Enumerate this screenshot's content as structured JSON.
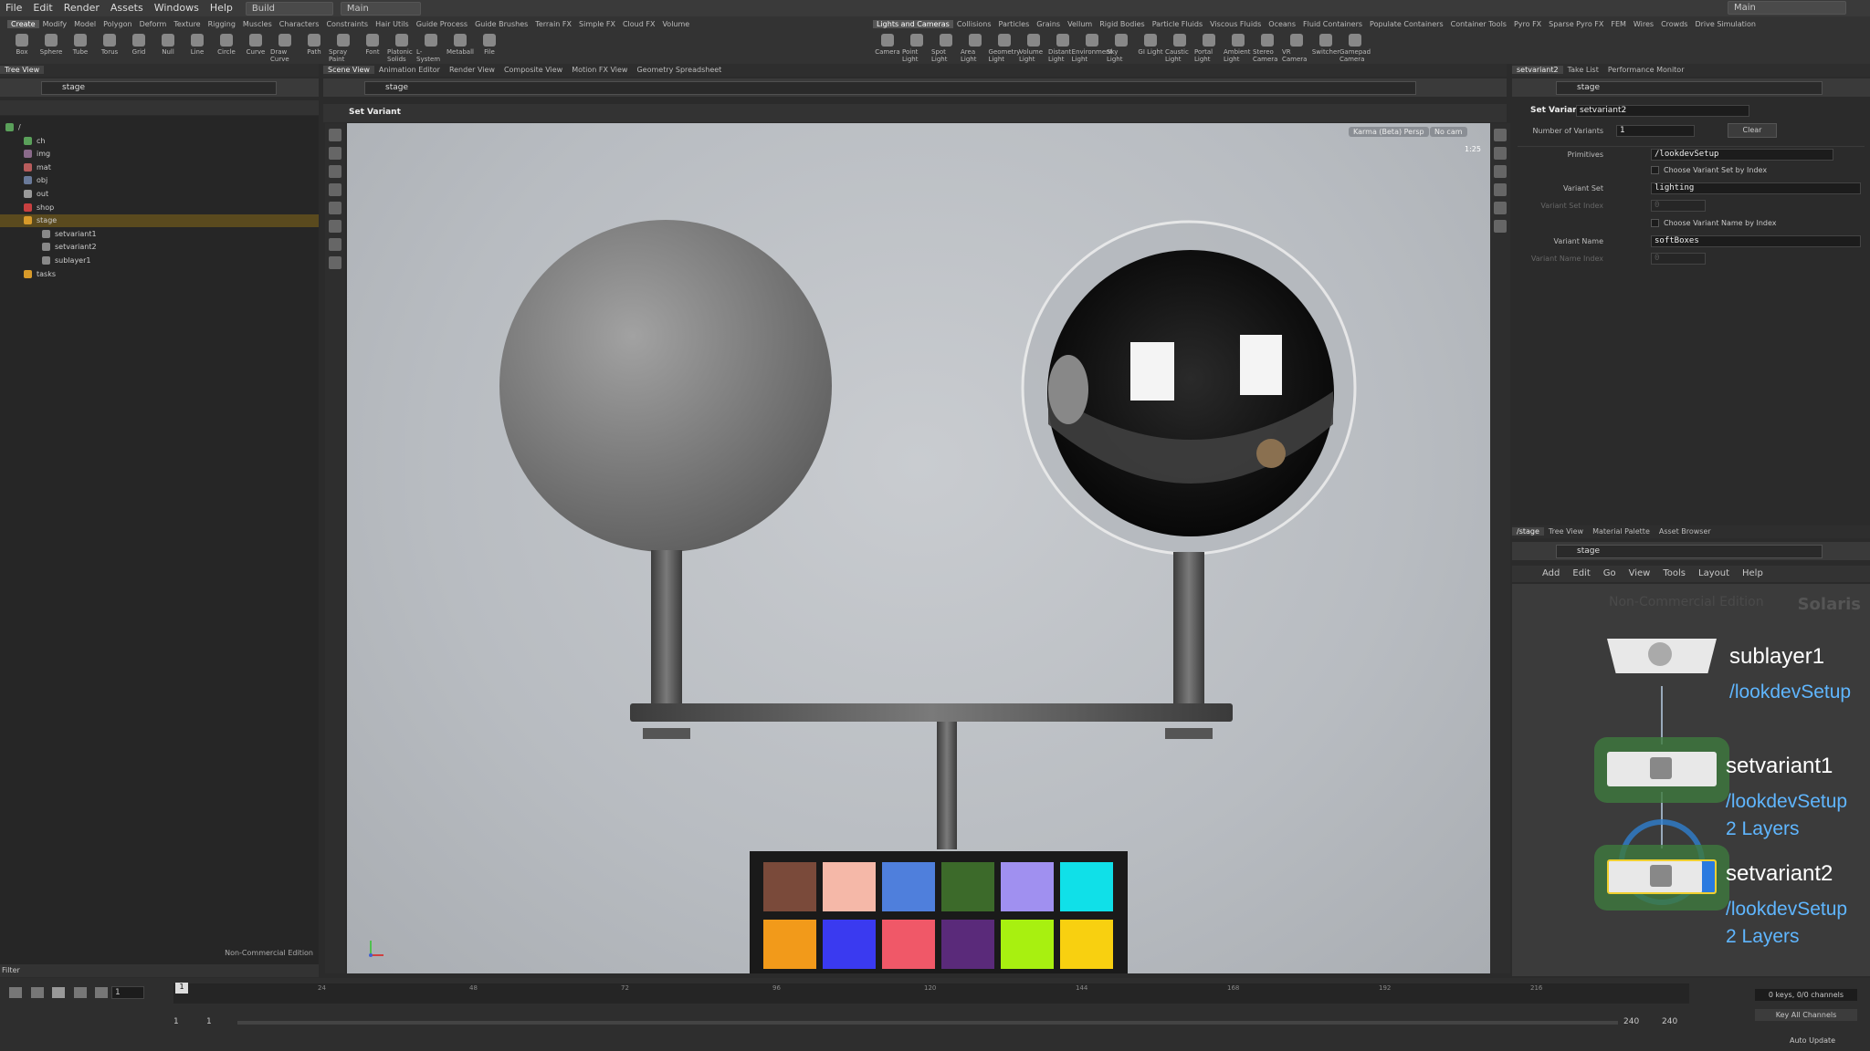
{
  "menubar": {
    "items": [
      "File",
      "Edit",
      "Render",
      "Assets",
      "Windows",
      "Help"
    ],
    "desktop": "Build",
    "network_context": "Main",
    "right_label": "Main"
  },
  "shelf": {
    "left_tabs": [
      "Create",
      "Modify",
      "Model",
      "Polygon",
      "Deform",
      "Texture",
      "Rigging",
      "Muscles",
      "Characters",
      "Constraints",
      "Hair Utils",
      "Guide Process",
      "Guide Brushes",
      "Terrain FX",
      "Simple FX",
      "Cloud FX",
      "Volume"
    ],
    "left_tools": [
      "Box",
      "Sphere",
      "Tube",
      "Torus",
      "Grid",
      "Null",
      "Line",
      "Circle",
      "Curve",
      "Draw Curve",
      "Path",
      "Spray Paint",
      "Font",
      "Platonic Solids",
      "L-System",
      "Metaball",
      "File"
    ],
    "right_tabs": [
      "Lights and Cameras",
      "Collisions",
      "Particles",
      "Grains",
      "Vellum",
      "Rigid Bodies",
      "Particle Fluids",
      "Viscous Fluids",
      "Oceans",
      "Fluid Containers",
      "Populate Containers",
      "Container Tools",
      "Pyro FX",
      "Sparse Pyro FX",
      "FEM",
      "Wires",
      "Crowds",
      "Drive Simulation"
    ],
    "right_tools": [
      "Camera",
      "Point Light",
      "Spot Light",
      "Area Light",
      "Geometry Light",
      "Volume Light",
      "Distant Light",
      "Environment Light",
      "Sky Light",
      "GI Light",
      "Caustic Light",
      "Portal Light",
      "Ambient Light",
      "Stereo Camera",
      "VR Camera",
      "Switcher",
      "Gamepad Camera"
    ]
  },
  "tree_pane": {
    "tab": "Tree View",
    "path": "stage",
    "nodes": [
      {
        "label": "/",
        "color": "#5aa05a",
        "indent": 0
      },
      {
        "label": "ch",
        "color": "#5aa05a",
        "indent": 1
      },
      {
        "label": "img",
        "color": "#8a6a8a",
        "indent": 1
      },
      {
        "label": "mat",
        "color": "#b85c5c",
        "indent": 1
      },
      {
        "label": "obj",
        "color": "#6a7a9a",
        "indent": 1
      },
      {
        "label": "out",
        "color": "#9a9a9a",
        "indent": 1
      },
      {
        "label": "shop",
        "color": "#c84040",
        "indent": 1
      },
      {
        "label": "stage",
        "color": "#d79a2a",
        "indent": 1,
        "selected": true
      },
      {
        "label": "setvariant1",
        "color": "#888888",
        "indent": 2
      },
      {
        "label": "setvariant2",
        "color": "#888888",
        "indent": 2
      },
      {
        "label": "sublayer1",
        "color": "#888888",
        "indent": 2
      },
      {
        "label": "tasks",
        "color": "#d79a2a",
        "indent": 1
      }
    ],
    "edition": "Non-Commercial Edition",
    "filter_label": "Filter"
  },
  "viewer": {
    "tabs": [
      "Scene View",
      "Animation Editor",
      "Render View",
      "Composite View",
      "Motion FX View",
      "Geometry Spreadsheet"
    ],
    "path": "stage",
    "node_title": "Set Variant",
    "renderer": "Karma (Beta) Persp",
    "camera": "No cam",
    "scale": "1:25",
    "colors": {
      "checker": [
        "#7a4a3a",
        "#f5b8a8",
        "#4f7fdc",
        "#3c6a2a",
        "#a090f0",
        "#10e0e8",
        "#f29a1a",
        "#3a3af0",
        "#f05868",
        "#5a2a7a",
        "#a8f010",
        "#f8d010"
      ]
    }
  },
  "params": {
    "tabs": [
      "setvariant2",
      "Take List",
      "Performance Monitor"
    ],
    "path": "stage",
    "node_type": "Set Variant",
    "node_name": "setvariant2",
    "num_variants_label": "Number of Variants",
    "num_variants_value": "1",
    "clear_label": "Clear",
    "primitives_label": "Primitives",
    "primitives_value": "/lookdevSetup",
    "choose_set_index": "Choose Variant Set by Index",
    "variant_set_label": "Variant Set",
    "variant_set_value": "lighting",
    "variant_set_index_label": "Variant Set Index",
    "variant_set_index_value": "0",
    "choose_name_index": "Choose Variant Name by Index",
    "variant_name_label": "Variant Name",
    "variant_name_value": "softBoxes",
    "variant_name_index_label": "Variant Name Index",
    "variant_name_index_value": "0"
  },
  "network": {
    "tabs": [
      "/stage",
      "Tree View",
      "Material Palette",
      "Asset Browser"
    ],
    "path": "stage",
    "menu": [
      "Add",
      "Edit",
      "Go",
      "View",
      "Tools",
      "Layout",
      "Help"
    ],
    "watermark": "Non-Commercial Edition",
    "context_label": "Solaris",
    "nodes": [
      {
        "name": "sublayer1",
        "sub": [
          "/lookdevSetup"
        ]
      },
      {
        "name": "setvariant1",
        "sub": [
          "/lookdevSetup",
          "2 Layers"
        ]
      },
      {
        "name": "setvariant2",
        "sub": [
          "/lookdevSetup",
          "2 Layers"
        ]
      }
    ]
  },
  "timeline": {
    "ticks": [
      "24",
      "48",
      "72",
      "96",
      "120",
      "144",
      "168",
      "192",
      "216"
    ],
    "current_frame": "1",
    "start": "1",
    "start2": "1",
    "end": "240",
    "end2": "240",
    "keys_status": "0 keys, 0/0 channels",
    "key_all": "Key All Channels",
    "auto_update": "Auto Update"
  }
}
